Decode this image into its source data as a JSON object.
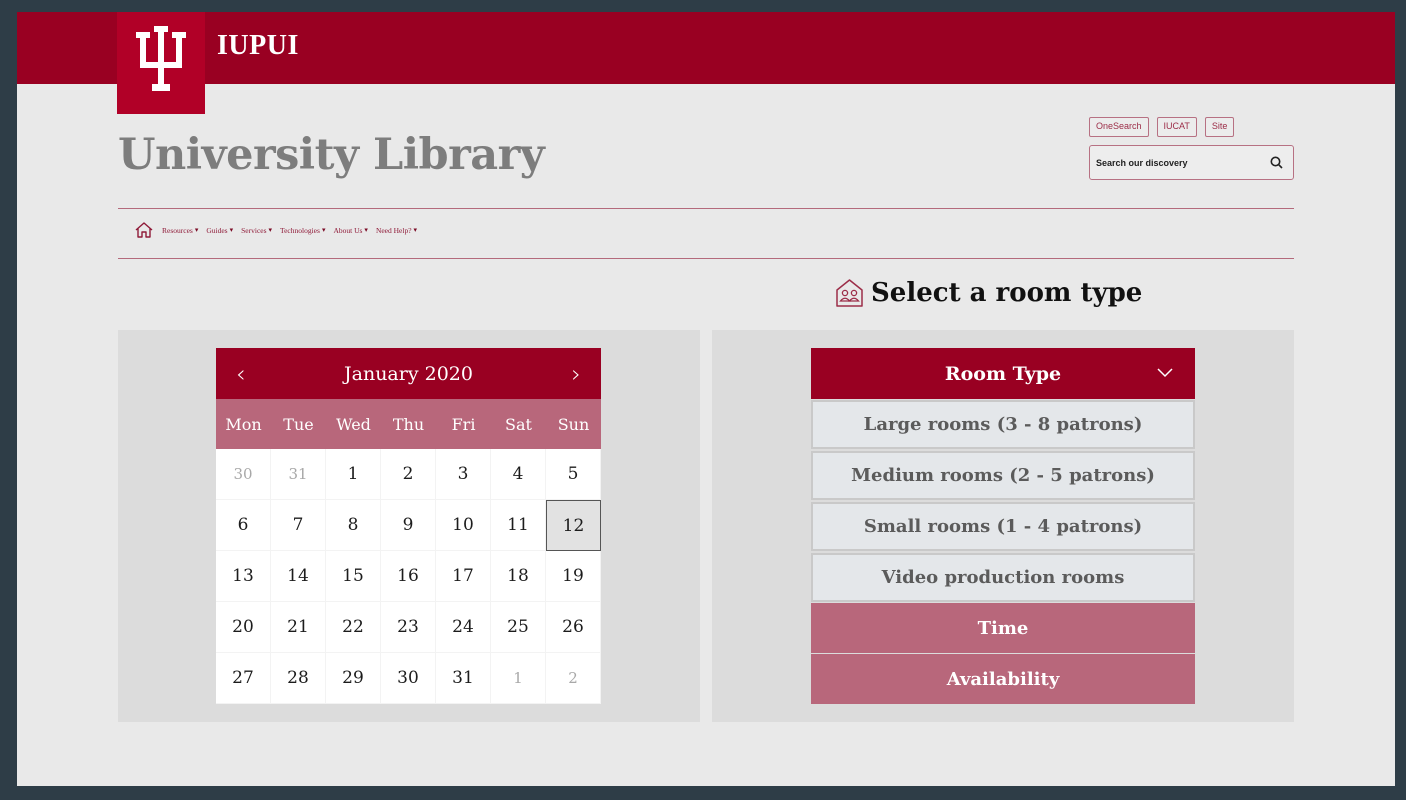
{
  "header": {
    "brand": "IUPUI",
    "site_title": "University Library",
    "logo_icon": "trident-icon"
  },
  "search": {
    "tabs": [
      "OneSearch",
      "IUCAT",
      "Site"
    ],
    "placeholder": "Search our discovery",
    "icon": "search-icon"
  },
  "nav": {
    "home_icon": "home-icon",
    "items": [
      {
        "label": "Resources"
      },
      {
        "label": "Guides"
      },
      {
        "label": "Services"
      },
      {
        "label": "Technologies"
      },
      {
        "label": "About Us"
      },
      {
        "label": "Need Help?"
      }
    ]
  },
  "section": {
    "title": "Select a room type",
    "icon": "room-people-icon"
  },
  "calendar": {
    "month_label": "January 2020",
    "prev": "‹",
    "next": "›",
    "weekdays": [
      "Mon",
      "Tue",
      "Wed",
      "Thu",
      "Fri",
      "Sat",
      "Sun"
    ],
    "days": [
      {
        "d": "30",
        "muted": true
      },
      {
        "d": "31",
        "muted": true
      },
      {
        "d": "1"
      },
      {
        "d": "2"
      },
      {
        "d": "3"
      },
      {
        "d": "4"
      },
      {
        "d": "5"
      },
      {
        "d": "6"
      },
      {
        "d": "7"
      },
      {
        "d": "8"
      },
      {
        "d": "9"
      },
      {
        "d": "10"
      },
      {
        "d": "11"
      },
      {
        "d": "12",
        "selected": true
      },
      {
        "d": "13"
      },
      {
        "d": "14"
      },
      {
        "d": "15"
      },
      {
        "d": "16"
      },
      {
        "d": "17"
      },
      {
        "d": "18"
      },
      {
        "d": "19"
      },
      {
        "d": "20"
      },
      {
        "d": "21"
      },
      {
        "d": "22"
      },
      {
        "d": "23"
      },
      {
        "d": "24"
      },
      {
        "d": "25"
      },
      {
        "d": "26"
      },
      {
        "d": "27"
      },
      {
        "d": "28"
      },
      {
        "d": "29"
      },
      {
        "d": "30"
      },
      {
        "d": "31"
      },
      {
        "d": "1",
        "muted": true
      },
      {
        "d": "2",
        "muted": true
      }
    ]
  },
  "room_type": {
    "header": "Room Type",
    "options": [
      "Large rooms (3 - 8 patrons)",
      "Medium rooms (2 - 5 patrons)",
      "Small rooms (1 - 4 patrons)",
      "Video production rooms"
    ],
    "steps": [
      "Time",
      "Availability"
    ]
  },
  "colors": {
    "brand_crimson": "#990022",
    "muted_rose": "#b8677b",
    "page_bg": "#e9e9e9"
  }
}
